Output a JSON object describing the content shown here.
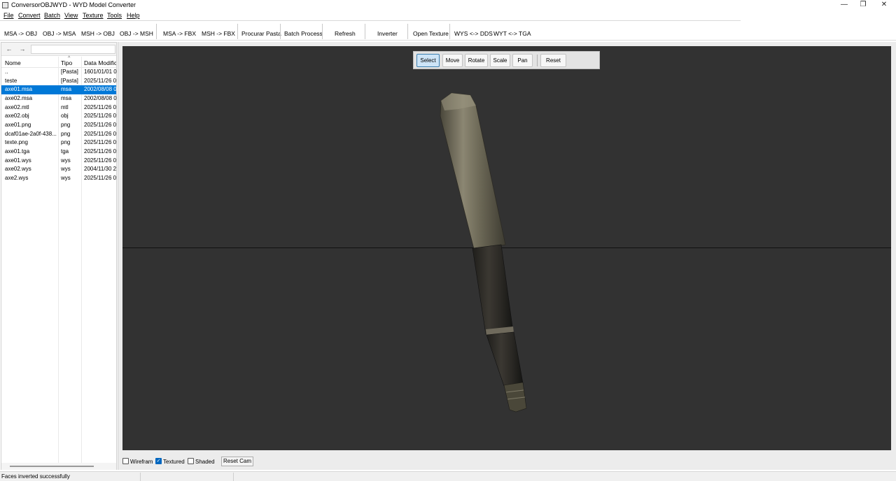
{
  "window": {
    "title": "ConversorOBJWYD - WYD Model Converter",
    "controls": {
      "minimize": "—",
      "restore": "❐",
      "close": "✕"
    }
  },
  "menu": [
    "File",
    "Convert",
    "Batch",
    "View",
    "Texture",
    "Tools",
    "Help"
  ],
  "toolbar": {
    "msa_to_obj": "MSA -> OBJ",
    "obj_to_msa": "OBJ -> MSA",
    "msh_to_obj": "MSH -> OBJ",
    "obj_to_msh": "OBJ -> MSH",
    "msa_to_fbx": "MSA -> FBX",
    "msh_to_fbx": "MSH -> FBX",
    "procurar_pasta": "Procurar Pasta",
    "batch_process": "Batch Process",
    "refresh": "Refresh",
    "inverter": "Inverter",
    "open_texture": "Open Texture",
    "wys_dds": "WYS <-> DDS",
    "wyt_tga": "WYT <-> TGA"
  },
  "browser": {
    "back": "←",
    "forward": "→",
    "path": "",
    "columns": {
      "name": "Nome",
      "type": "Tipo",
      "date": "Data Modific"
    },
    "files": [
      {
        "name": "..",
        "type": "[Pasta]",
        "date": "1601/01/01 0("
      },
      {
        "name": "teste",
        "type": "[Pasta]",
        "date": "2025/11/26 0:"
      },
      {
        "name": "axe01.msa",
        "type": "msa",
        "date": "2002/08/08 0(",
        "selected": true
      },
      {
        "name": "axe02.msa",
        "type": "msa",
        "date": "2002/08/08 0("
      },
      {
        "name": "axe02.mtl",
        "type": "mtl",
        "date": "2025/11/26 0:"
      },
      {
        "name": "axe02.obj",
        "type": "obj",
        "date": "2025/11/26 0:"
      },
      {
        "name": "axe01.png",
        "type": "png",
        "date": "2025/11/26 0:"
      },
      {
        "name": "dcaf01ae-2a0f-438...",
        "type": "png",
        "date": "2025/11/26 0:"
      },
      {
        "name": "texte.png",
        "type": "png",
        "date": "2025/11/26 0:"
      },
      {
        "name": "axe01.tga",
        "type": "tga",
        "date": "2025/11/26 0:"
      },
      {
        "name": "axe01.wys",
        "type": "wys",
        "date": "2025/11/26 0:"
      },
      {
        "name": "axe02.wys",
        "type": "wys",
        "date": "2004/11/30 2:"
      },
      {
        "name": "axe2.wys",
        "type": "wys",
        "date": "2025/11/26 0:"
      }
    ]
  },
  "viewport_toolbar": {
    "select": "Select",
    "move": "Move",
    "rotate": "Rotate",
    "scale": "Scale",
    "pan": "Pan",
    "reset": "Reset",
    "active": "Select"
  },
  "render_options": {
    "wireframe": {
      "label": "Wirefram",
      "checked": false
    },
    "textured": {
      "label": "Textured",
      "checked": true
    },
    "shaded": {
      "label": "Shaded",
      "checked": false
    },
    "reset_cam": "Reset Cam"
  },
  "status": {
    "message": "Faces inverted successfully"
  },
  "colors": {
    "selection": "#0078d7",
    "viewport_bg": "#323232",
    "active_tool": "#cde4f7"
  }
}
